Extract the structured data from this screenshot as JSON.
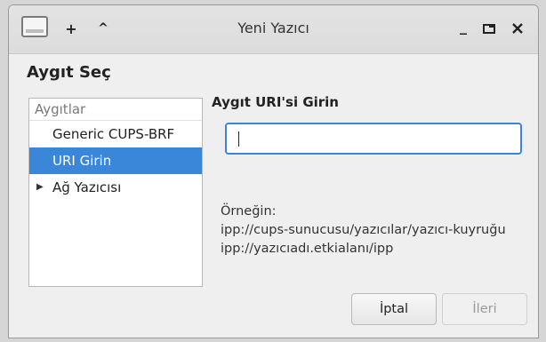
{
  "window": {
    "title": "Yeni Yazıcı",
    "icon": "printer-app-icon",
    "controls": {
      "pin": "+",
      "above": "^",
      "minimize": "_",
      "maximize": "□",
      "close": "✕"
    }
  },
  "page": {
    "heading": "Aygıt Seç"
  },
  "devices": {
    "header": "Aygıtlar",
    "items": [
      {
        "label": "Generic CUPS-BRF",
        "selected": false,
        "expandable": false
      },
      {
        "label": "URI Girin",
        "selected": true,
        "expandable": false
      },
      {
        "label": "Ağ Yazıcısı",
        "selected": false,
        "expandable": true
      }
    ]
  },
  "uri": {
    "title": "Aygıt URI'si Girin",
    "value": "",
    "example_label": "Örneğin:",
    "example_line1": "ipp://cups-sunucusu/yazıcılar/yazıcı-kuyruğu",
    "example_line2": "ipp://yazıcıadı.etkialanı/ipp"
  },
  "buttons": {
    "cancel": "İptal",
    "next": "İleri"
  },
  "colors": {
    "accent": "#3a86d9",
    "background": "#efefef"
  }
}
